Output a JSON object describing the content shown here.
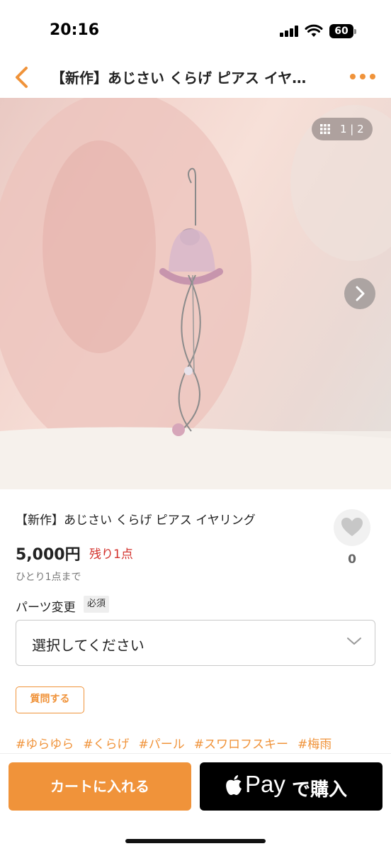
{
  "status_bar": {
    "time": "20:16",
    "battery": "60",
    "icons": [
      "signal-icon",
      "wifi-icon",
      "battery-icon"
    ]
  },
  "nav": {
    "title": "【新作】あじさい くらげ ピアス イヤ…",
    "icons": [
      "back-icon",
      "more-icon"
    ],
    "accent_color": "#f0933a"
  },
  "gallery": {
    "pager": "1 | 2",
    "icons": [
      "grid-icon",
      "chevron-right-icon"
    ]
  },
  "product": {
    "name": "【新作】あじさい くらげ ピアス イヤリング",
    "price": "5,000円",
    "stock": "残り1点",
    "limit": "ひとり1点まで",
    "likes": "0",
    "price_color": "#222222",
    "stock_color": "#d3322d"
  },
  "options": {
    "label": "パーツ変更",
    "required": "必須",
    "select_value": "選択してください"
  },
  "question_button": "質問する",
  "tags": [
    "#ゆらゆら",
    "#くらげ",
    "#パール",
    "#スワロフスキー",
    "#梅雨"
  ],
  "bottom_bar": {
    "cart_label": "カートに入れる",
    "applepay_pay": "Pay",
    "applepay_buy": "で購入"
  }
}
